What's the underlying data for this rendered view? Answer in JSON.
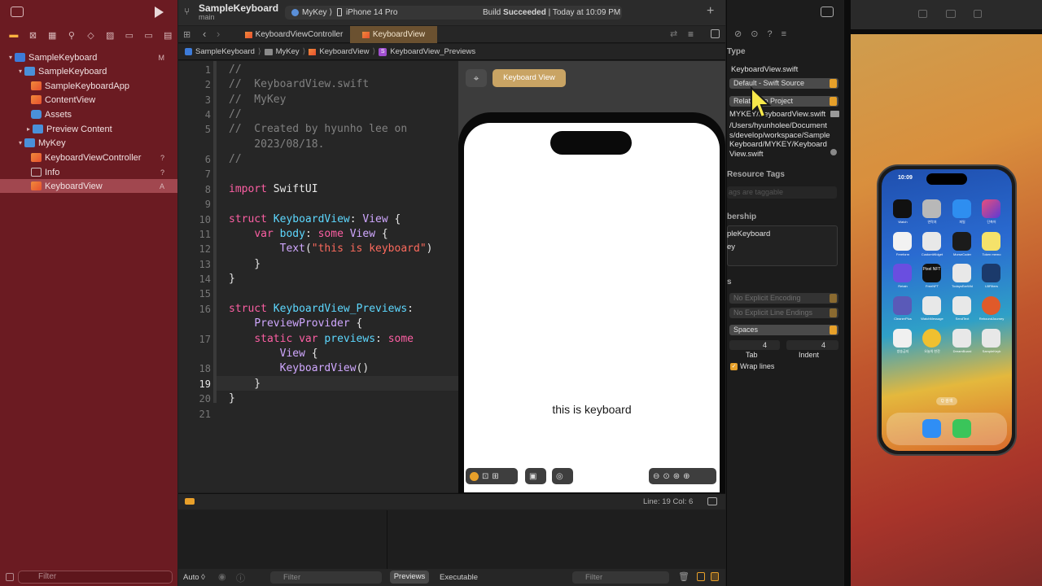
{
  "toolbar": {
    "project": "SampleKeyboard",
    "branch": "main",
    "scheme_target": "MyKey",
    "device": "iPhone 14 Pro",
    "build_prefix": "Build",
    "build_status": "Succeeded",
    "build_time": "| Today at 10:09 PM"
  },
  "navigator": {
    "items": [
      {
        "label": "SampleKeyboard",
        "status": "M"
      },
      {
        "label": "SampleKeyboard",
        "status": ""
      },
      {
        "label": "SampleKeyboardApp",
        "status": ""
      },
      {
        "label": "ContentView",
        "status": ""
      },
      {
        "label": "Assets",
        "status": ""
      },
      {
        "label": "Preview Content",
        "status": ""
      },
      {
        "label": "MyKey",
        "status": ""
      },
      {
        "label": "KeyboardViewController",
        "status": "?"
      },
      {
        "label": "Info",
        "status": "?"
      },
      {
        "label": "KeyboardView",
        "status": "A"
      }
    ],
    "filter_placeholder": "Filter"
  },
  "tabs": [
    {
      "label": "KeyboardViewController"
    },
    {
      "label": "KeyboardView"
    }
  ],
  "breadcrumb": [
    "SampleKeyboard",
    "MyKey",
    "KeyboardView",
    "KeyboardView_Previews"
  ],
  "editor": {
    "line_numbers": [
      "1",
      "2",
      "3",
      "4",
      "5",
      "",
      "6",
      "7",
      "8",
      "9",
      "10",
      "11",
      "12",
      "13",
      "14",
      "15",
      "16",
      "",
      "17",
      "",
      "18",
      "19",
      "20",
      "21"
    ]
  },
  "preview": {
    "pin_label": "⌖",
    "view_button": "Keyboard View",
    "rendered_text": "this is keyboard"
  },
  "status": {
    "position": "Line: 19  Col: 6"
  },
  "bottom": {
    "auto": "Auto ◊",
    "filter1": "Filter",
    "previews": "Previews",
    "executable": "Executable",
    "filter2": "Filter"
  },
  "inspector": {
    "type_heading": "Type",
    "file_name": "KeyboardView.swift",
    "file_type": "Default - Swift Source",
    "location": "Relative to Project",
    "full_name": "MYKEY/KeyboardView.swift",
    "path": "/Users/hyunholee/Documents/develop/workspace/SampleKeyboard/MYKEY/KeyboardView.swift",
    "resource_tags_heading": "Resource Tags",
    "resource_tags_placeholder": "ags are taggable",
    "membership_heading": "bership",
    "membership_items": [
      "pleKeyboard",
      "ey"
    ],
    "text_settings_heading": "s",
    "encoding": "No Explicit Encoding",
    "line_endings": "No Explicit Line Endings",
    "indent_using": "Spaces",
    "tab_value": "4",
    "indent_value": "4",
    "tab_label": "Tab",
    "indent_label": "Indent",
    "wrap_lines": "Wrap lines"
  },
  "simulator": {
    "time": "10:09",
    "apps": [
      "Watch",
      "연락처",
      "파일",
      "단축어",
      "Freeform",
      "CustomWidget",
      "MorseCoder",
      "Token memo",
      "Retain",
      "FreeNFT",
      "TodaysEarWid",
      "LBFilters",
      "CleanerPlus",
      "WatchMessage",
      "SendText",
      "ReboundJourney",
      "방송금지",
      "오늘의 한잔",
      "DreamBoard",
      "SampleKeyb"
    ],
    "pixel_nft": "Pixel NFT",
    "search_label": "Q 검색"
  }
}
